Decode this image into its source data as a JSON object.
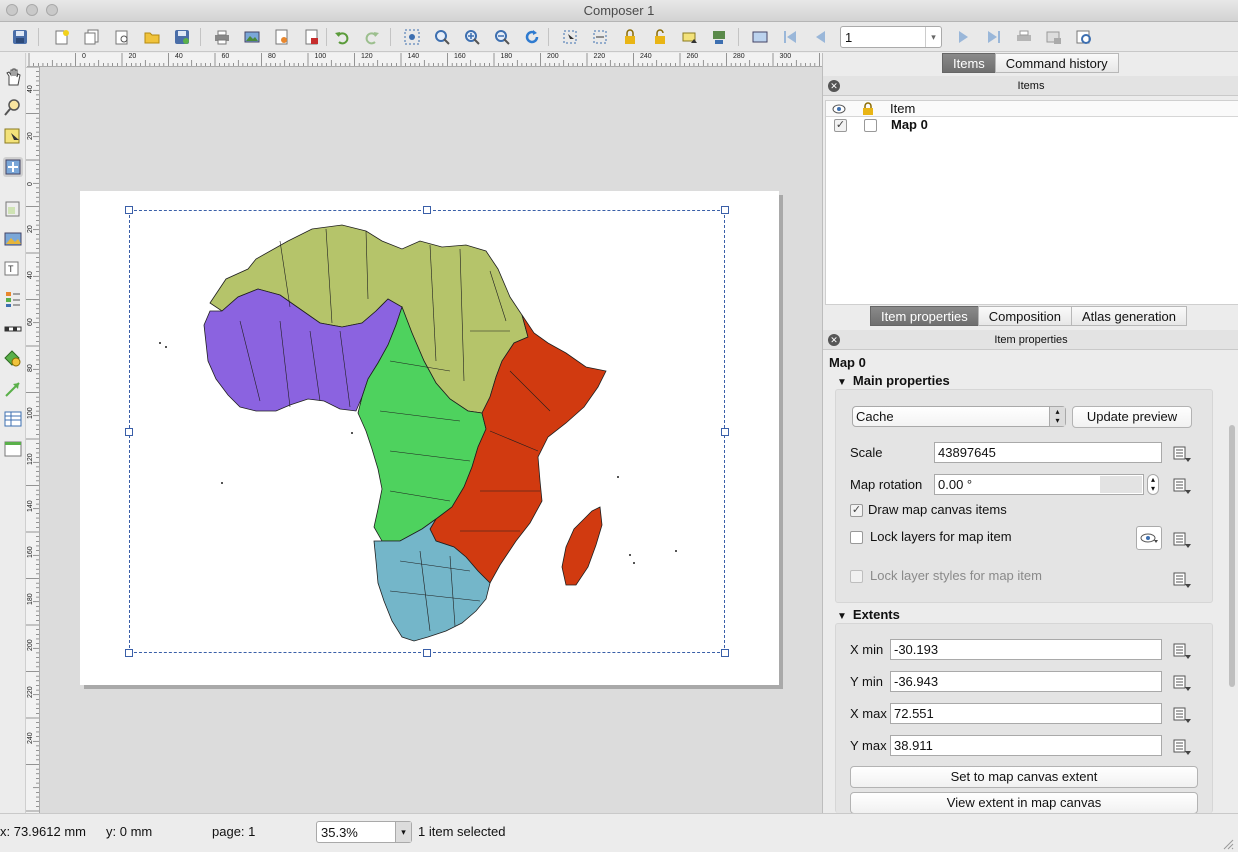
{
  "window": {
    "title": "Composer 1"
  },
  "toolbar": {
    "page_value": "1",
    "icons": [
      "save-icon",
      "new-composer-icon",
      "duplicate-composer-icon",
      "composer-manager-icon",
      "load-template-icon",
      "save-template-icon",
      "print-icon",
      "export-image-icon",
      "export-svg-icon",
      "export-pdf-icon",
      "undo-icon",
      "redo-icon",
      "zoom-full-icon",
      "zoom-actual-icon",
      "zoom-in-icon",
      "zoom-out-icon",
      "refresh-icon",
      "select-all-icon",
      "deselect-icon",
      "lock-icon",
      "unlock-icon",
      "raise-icon",
      "align-icon",
      "atlas-preview-icon",
      "first-feature-icon",
      "previous-feature-icon",
      "next-feature-icon",
      "last-feature-icon",
      "atlas-print-icon",
      "atlas-export-icon",
      "atlas-settings-icon"
    ]
  },
  "tools": [
    "pan-tool-icon",
    "zoom-tool-icon",
    "select-tool-icon",
    "move-content-tool-icon",
    "add-map-icon",
    "add-image-icon",
    "add-label-icon",
    "add-legend-icon",
    "add-scalebar-icon",
    "add-shape-icon",
    "add-arrow-icon",
    "add-table-icon",
    "add-html-icon"
  ],
  "rulers": {
    "h_labels": [
      "0",
      "20",
      "40",
      "60",
      "80",
      "100",
      "120",
      "140",
      "160",
      "180",
      "200",
      "220",
      "240",
      "260",
      "280",
      "300"
    ],
    "v_labels": [
      "40",
      "20",
      "0",
      "20",
      "40",
      "60",
      "80",
      "100",
      "120",
      "140",
      "160",
      "180",
      "200",
      "220",
      "240"
    ]
  },
  "items_panel": {
    "tabs": [
      "Items",
      "Command history"
    ],
    "active_tab": "Items",
    "header": "Items",
    "column_item": "Item",
    "rows": [
      {
        "name": "Map 0",
        "visible": true,
        "locked": false
      }
    ]
  },
  "properties_panel": {
    "tabs": [
      "Item properties",
      "Composition",
      "Atlas generation"
    ],
    "active_tab": "Item properties",
    "header": "Item properties",
    "item_title": "Map 0",
    "main_section": "Main properties",
    "preview_mode": "Cache",
    "update_preview": "Update preview",
    "scale_label": "Scale",
    "scale_value": "43897645",
    "rotation_label": "Map rotation",
    "rotation_value": "0.00 °",
    "draw_canvas_items": "Draw map canvas items",
    "draw_canvas_items_checked": true,
    "lock_layers": "Lock layers for map item",
    "lock_layers_checked": false,
    "lock_styles": "Lock layer styles for map item",
    "lock_styles_checked": false,
    "extents_section": "Extents",
    "xmin_label": "X min",
    "xmin_value": "-30.193",
    "ymin_label": "Y min",
    "ymin_value": "-36.943",
    "xmax_label": "X max",
    "xmax_value": "72.551",
    "ymax_label": "Y max",
    "ymax_value": "38.911",
    "set_extent": "Set to map canvas extent",
    "view_extent": "View extent in map canvas"
  },
  "status": {
    "x": "x: 73.9612 mm",
    "y": "y: 0 mm",
    "page": "page: 1",
    "zoom": "35.3%",
    "selection": "1 item selected"
  },
  "map_colors": {
    "north": "#b5c46a",
    "west": "#8b63e0",
    "central": "#4ed25e",
    "east": "#d13a10",
    "south": "#74b6c9"
  }
}
